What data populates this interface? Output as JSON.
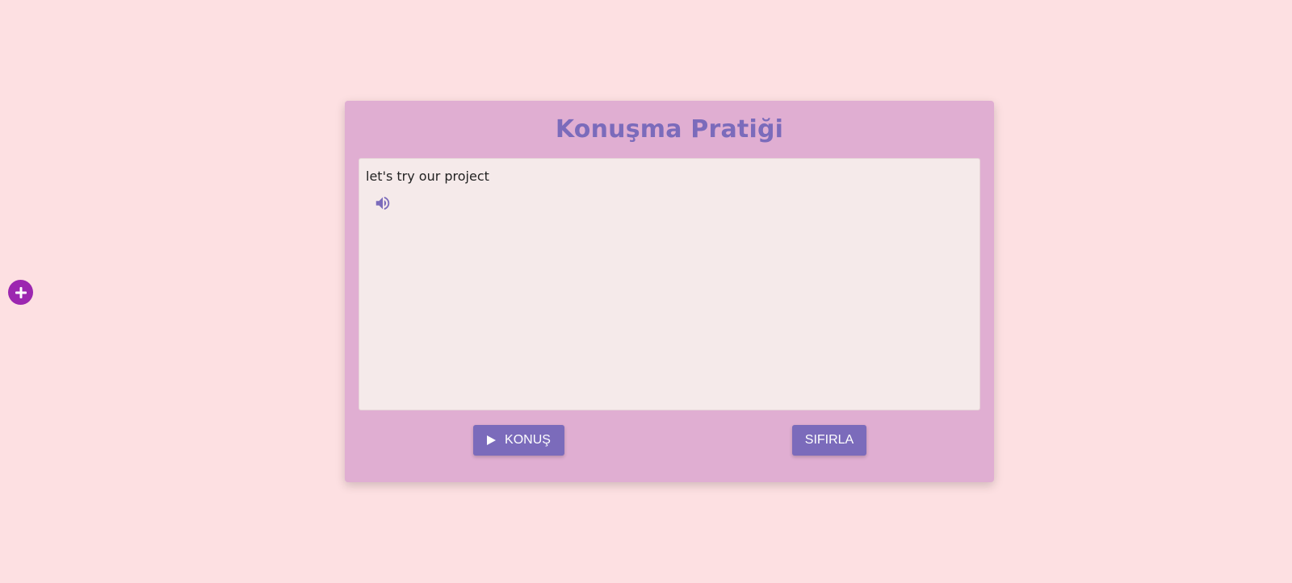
{
  "card": {
    "title": "Konuşma Pratiği"
  },
  "conversation": {
    "messages": [
      {
        "text": "let's try our project",
        "action_icon": "speaker-icon"
      }
    ]
  },
  "controls": {
    "speak_label": "KONUŞ",
    "speak_icon": "play-icon",
    "reset_label": "SIFIRLA"
  },
  "fab": {
    "icon": "plus-icon"
  },
  "colors": {
    "background": "#fde0e2",
    "card": "#e0aed2",
    "panel": "#f5eaea",
    "accent": "#7b6bbb",
    "fab": "#9c27b0"
  }
}
